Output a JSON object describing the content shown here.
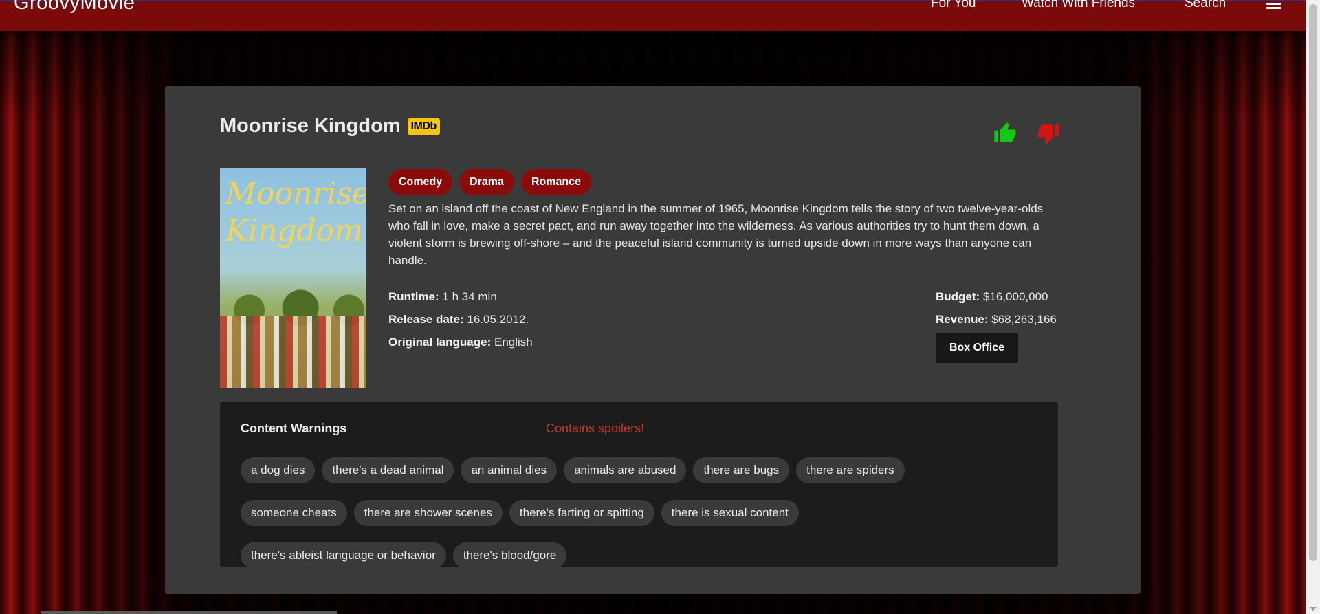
{
  "app": {
    "brand": "GroovyMovie",
    "nav": [
      "For You",
      "Watch With Friends",
      "Search"
    ]
  },
  "movie": {
    "title": "Moonrise Kingdom",
    "imdb_label": "IMDb",
    "poster_title": "Moonrise Kingdom",
    "genres": [
      "Comedy",
      "Drama",
      "Romance"
    ],
    "overview": "Set on an island off the coast of New England in the summer of 1965, Moonrise Kingdom tells the story of two twelve-year-olds who fall in love, make a secret pact, and run away together into the wilderness. As various authorities try to hunt them down, a violent storm is brewing off-shore – and the peaceful island community is turned upside down in more ways than anyone can handle.",
    "facts": {
      "runtime_label": "Runtime:",
      "runtime": "1 h 34 min",
      "release_label": "Release date:",
      "release": "16.05.2012.",
      "language_label": "Original language:",
      "language": "English"
    },
    "money": {
      "budget_label": "Budget:",
      "budget": "$16,000,000",
      "revenue_label": "Revenue:",
      "revenue": "$68,263,166",
      "box_office_button": "Box Office"
    }
  },
  "warnings": {
    "title": "Content Warnings",
    "spoiler_note": "Contains spoilers!",
    "items": [
      "a dog dies",
      "there's a dead animal",
      "an animal dies",
      "animals are abused",
      "there are bugs",
      "there are spiders",
      "someone cheats",
      "there are shower scenes",
      "there's farting or spitting",
      "there is sexual content",
      "there's ableist language or behavior",
      "there's blood/gore"
    ]
  },
  "colors": {
    "accent": "#8b0b0b",
    "like": "#14c814",
    "dislike": "#d01515",
    "imdb": "#f5c518"
  }
}
